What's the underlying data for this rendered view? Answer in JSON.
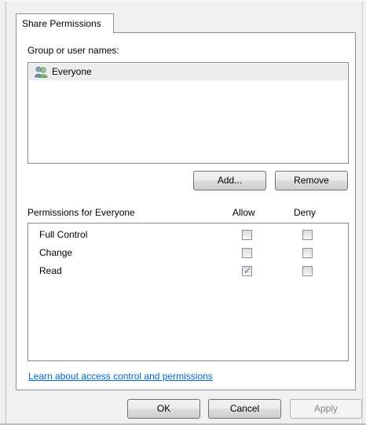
{
  "tabs": [
    {
      "label": "Share Permissions"
    }
  ],
  "group_label": "Group or user names:",
  "users": [
    {
      "name": "Everyone",
      "icon": "users-group-icon"
    }
  ],
  "buttons": {
    "add": "Add...",
    "remove": "Remove",
    "ok": "OK",
    "cancel": "Cancel",
    "apply": "Apply"
  },
  "permissions": {
    "header": "Permissions for Everyone",
    "allow_label": "Allow",
    "deny_label": "Deny",
    "rows": [
      {
        "name": "Full Control",
        "allow": false,
        "deny": false
      },
      {
        "name": "Change",
        "allow": false,
        "deny": false
      },
      {
        "name": "Read",
        "allow": true,
        "deny": false
      }
    ]
  },
  "help_link": "Learn about access control and permissions",
  "colors": {
    "link": "#0066cc",
    "selection": "#ececec",
    "check": "#5a6aa8"
  }
}
